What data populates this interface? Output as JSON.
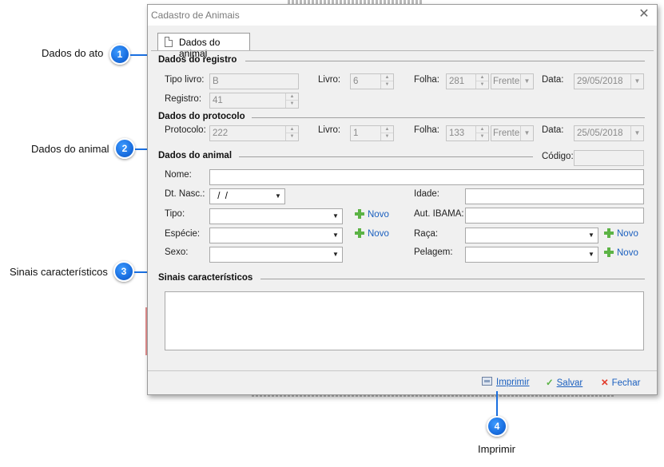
{
  "callouts": [
    {
      "num": "1",
      "label": "Dados do ato"
    },
    {
      "num": "2",
      "label": "Dados do animal"
    },
    {
      "num": "3",
      "label": "Sinais característicos"
    },
    {
      "num": "4",
      "label": "Imprimir"
    }
  ],
  "window": {
    "title": "Cadastro de Animais"
  },
  "tabs": [
    {
      "label": "Dados do animal"
    }
  ],
  "registro": {
    "title": "Dados do registro",
    "tipo_livro_label": "Tipo livro:",
    "tipo_livro_value": "B",
    "livro_label": "Livro:",
    "livro_value": "6",
    "folha_label": "Folha:",
    "folha_value": "281",
    "folha_lado": "Frente",
    "data_label": "Data:",
    "data_value": "29/05/2018",
    "registro_label": "Registro:",
    "registro_value": "41"
  },
  "protocolo": {
    "title": "Dados do protocolo",
    "protocolo_label": "Protocolo:",
    "protocolo_value": "222",
    "livro_label": "Livro:",
    "livro_value": "1",
    "folha_label": "Folha:",
    "folha_value": "133",
    "folha_lado": "Frente",
    "data_label": "Data:",
    "data_value": "25/05/2018"
  },
  "animal": {
    "title": "Dados do animal",
    "codigo_label": "Código:",
    "codigo_value": "",
    "nome_label": "Nome:",
    "nome_value": "",
    "dt_nasc_label": "Dt. Nasc.:",
    "dt_nasc_value": " /  /",
    "idade_label": "Idade:",
    "idade_value": "",
    "tipo_label": "Tipo:",
    "tipo_value": "",
    "aut_ibama_label": "Aut. IBAMA:",
    "aut_ibama_value": "",
    "especie_label": "Espécie:",
    "especie_value": "",
    "raca_label": "Raça:",
    "raca_value": "",
    "sexo_label": "Sexo:",
    "sexo_value": "",
    "pelagem_label": "Pelagem:",
    "pelagem_value": "",
    "novo_label": "Novo"
  },
  "sinais": {
    "title": "Sinais característicos",
    "value": ""
  },
  "footer": {
    "imprimir": "Imprimir",
    "salvar": "Salvar",
    "fechar": "Fechar"
  }
}
